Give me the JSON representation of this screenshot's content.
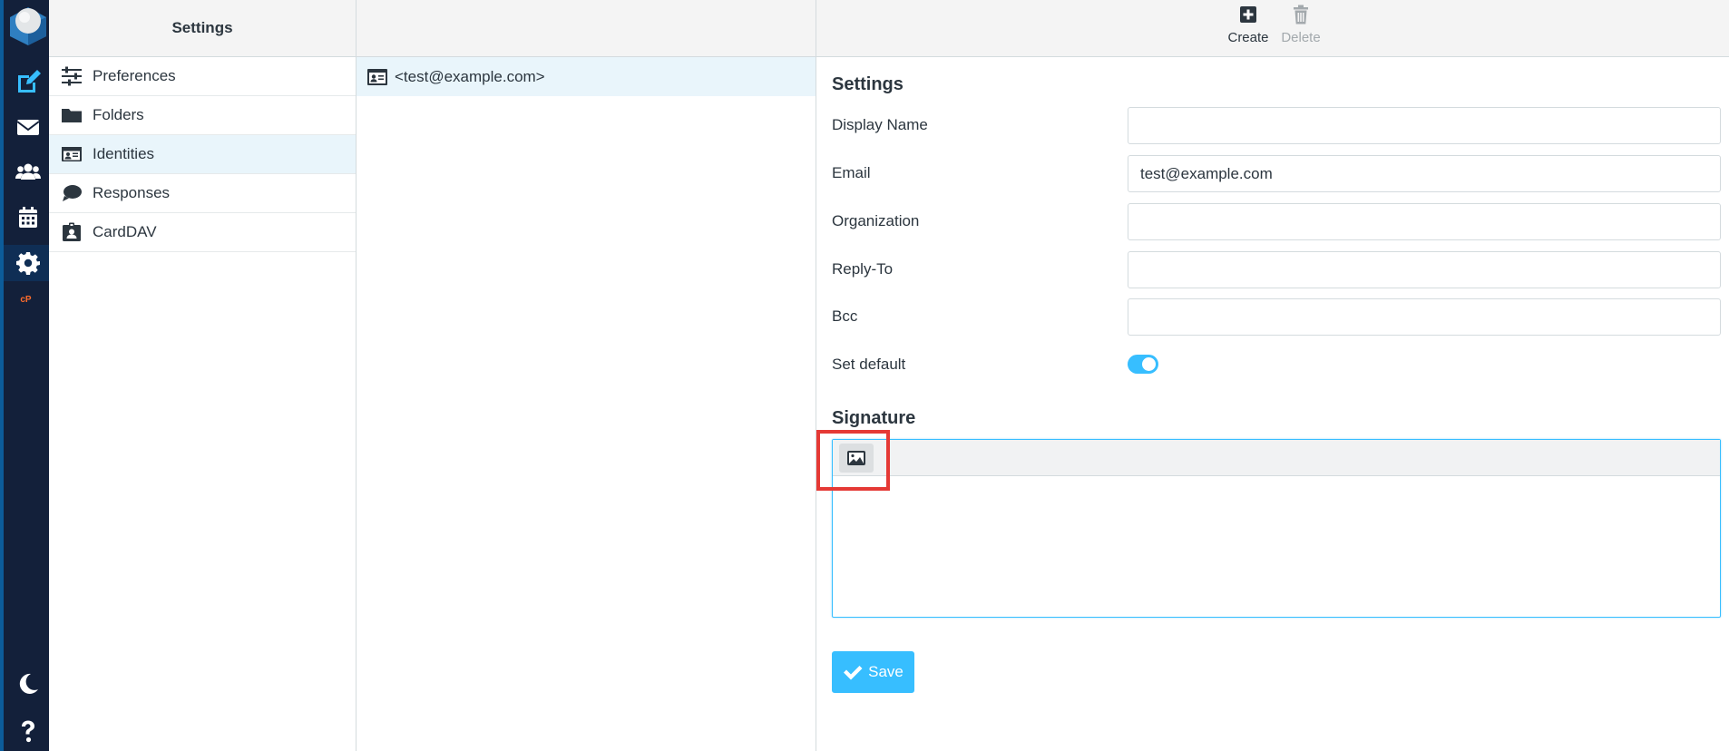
{
  "rail": {
    "items": [
      {
        "name": "compose-icon",
        "active": false
      },
      {
        "name": "mail-icon",
        "active": false
      },
      {
        "name": "contacts-icon",
        "active": false
      },
      {
        "name": "calendar-icon",
        "active": false
      },
      {
        "name": "settings-gear-icon",
        "active": true
      },
      {
        "name": "cpanel-icon",
        "active": false
      },
      {
        "name": "dark-mode-moon-icon",
        "active": false
      },
      {
        "name": "help-icon",
        "active": false
      }
    ]
  },
  "settings_column": {
    "title": "Settings",
    "items": [
      {
        "label": "Preferences",
        "icon": "sliders-icon",
        "selected": false
      },
      {
        "label": "Folders",
        "icon": "folder-icon",
        "selected": false
      },
      {
        "label": "Identities",
        "icon": "id-card-icon",
        "selected": true
      },
      {
        "label": "Responses",
        "icon": "speech-bubble-icon",
        "selected": false
      },
      {
        "label": "CardDAV",
        "icon": "contact-badge-icon",
        "selected": false
      }
    ]
  },
  "identities_column": {
    "items": [
      {
        "label": "<test@example.com>",
        "icon": "id-card-icon"
      }
    ]
  },
  "toolbar": {
    "create_label": "Create",
    "delete_label": "Delete"
  },
  "form": {
    "settings_title": "Settings",
    "fields": {
      "display_name": {
        "label": "Display Name",
        "value": ""
      },
      "email": {
        "label": "Email",
        "value": "test@example.com"
      },
      "organization": {
        "label": "Organization",
        "value": ""
      },
      "reply_to": {
        "label": "Reply-To",
        "value": ""
      },
      "bcc": {
        "label": "Bcc",
        "value": ""
      }
    },
    "set_default": {
      "label": "Set default",
      "on": true
    },
    "signature_title": "Signature",
    "signature_value": ""
  },
  "save_label": "Save",
  "colors": {
    "accent": "#37beff",
    "rail": "#13203a",
    "highlight": "#e53935"
  }
}
